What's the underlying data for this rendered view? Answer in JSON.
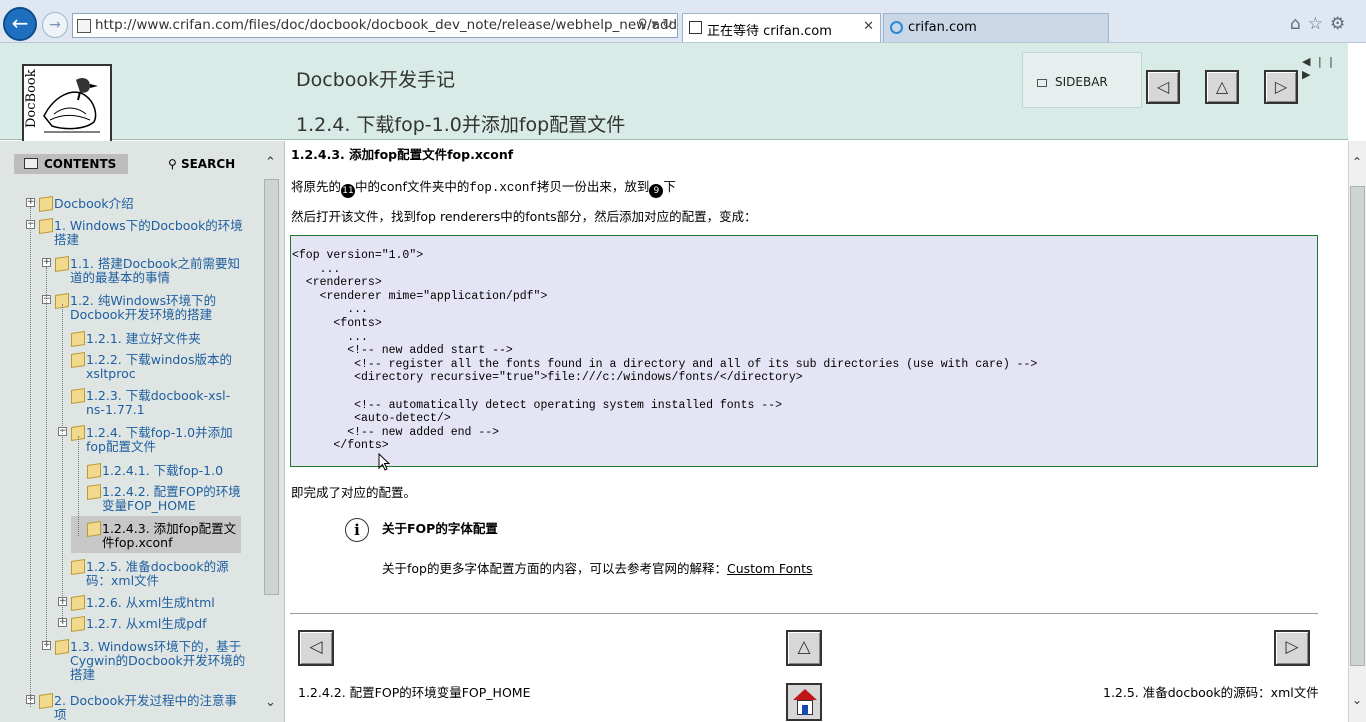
{
  "browser": {
    "url": "http://www.crifan.com/files/doc/docbook/docbook_dev_note/release/webhelp_new/add_fc",
    "tabs": [
      {
        "label": "正在等待 crifan.com"
      },
      {
        "label": "crifan.com"
      }
    ]
  },
  "header": {
    "logo_alt": "DocBook",
    "book_title": "Docbook开发手记",
    "section_title": "1.2.4. 下载fop-1.0并添加fop配置文件",
    "sidebar_label": "SIDEBAR",
    "nav_prev": "◁",
    "nav_up": "△",
    "nav_next": "▷",
    "ctl": "◀ | | ▶"
  },
  "sidebar": {
    "tab_contents": "CONTENTS",
    "tab_search": "SEARCH",
    "items": [
      {
        "label": "Docbook介绍",
        "lines": [
          "Docbook介绍"
        ],
        "exp": "+"
      },
      {
        "label": "1. Windows下的Docbook的环境搭建",
        "lines": [
          "1. Windows下的Docbook的环境",
          "搭建"
        ],
        "exp": "−"
      },
      {
        "label": "1.1. 搭建Docbook之前需要知道的最基本的事情",
        "lines": [
          "1.1. 搭建Docbook之前需要知",
          "道的最基本的事情"
        ],
        "exp": "+"
      },
      {
        "label": "1.2. 纯Windows环境下的Docbook开发环境的搭建",
        "lines": [
          "1.2. 纯Windows环境下的",
          "Docbook开发环境的搭建"
        ],
        "exp": "−"
      },
      {
        "label": "1.2.1. 建立好文件夹",
        "lines": [
          "1.2.1. 建立好文件夹"
        ],
        "exp": ""
      },
      {
        "label": "1.2.2. 下载windos版本的xsltproc",
        "lines": [
          "1.2.2. 下载windos版本的",
          "xsltproc"
        ],
        "exp": ""
      },
      {
        "label": "1.2.3. 下载docbook-xsl-ns-1.77.1",
        "lines": [
          "1.2.3. 下载docbook-xsl-",
          "ns-1.77.1"
        ],
        "exp": ""
      },
      {
        "label": "1.2.4. 下载fop-1.0并添加fop配置文件",
        "lines": [
          "1.2.4. 下载fop-1.0并添加",
          "fop配置文件"
        ],
        "exp": "−"
      },
      {
        "label": "1.2.4.1. 下载fop-1.0",
        "lines": [
          "1.2.4.1. 下载fop-1.0"
        ],
        "exp": ""
      },
      {
        "label": "1.2.4.2. 配置FOP的环境变量FOP_HOME",
        "lines": [
          "1.2.4.2. 配置FOP的环境",
          "变量FOP_HOME"
        ],
        "exp": ""
      },
      {
        "label": "1.2.4.3. 添加fop配置文件fop.xconf",
        "lines": [
          "1.2.4.3. 添加fop配置文",
          "件fop.xconf"
        ],
        "exp": ""
      },
      {
        "label": "1.2.5. 准备docbook的源码：xml文件",
        "lines": [
          "1.2.5. 准备docbook的源",
          "码：xml文件"
        ],
        "exp": ""
      },
      {
        "label": "1.2.6. 从xml生成html",
        "lines": [
          "1.2.6. 从xml生成html"
        ],
        "exp": "+"
      },
      {
        "label": "1.2.7. 从xml生成pdf",
        "lines": [
          "1.2.7. 从xml生成pdf"
        ],
        "exp": "+"
      },
      {
        "label": "1.3. Windows环境下的，基于Cygwin的Docbook开发环境的搭建",
        "lines": [
          "1.3. Windows环境下的，基于",
          "Cygwin的Docbook开发环境的",
          "搭建"
        ],
        "exp": "+"
      },
      {
        "label": "2. Docbook开发过程中的注意事项",
        "lines": [
          "2. Docbook开发过程中的注意事",
          "项"
        ],
        "exp": "+"
      }
    ]
  },
  "content": {
    "heading": "1.2.4.3. 添加fop配置文件fop.xconf",
    "para1_a": "将原先的",
    "para1_badge1": "11",
    "para1_b": "中的conf文件夹中的",
    "para1_code": "fop.xconf",
    "para1_c": "拷贝一份出来，放到",
    "para1_badge2": "9",
    "para1_d": "下",
    "para2": "然后打开该文件，找到fop  renderers中的fonts部分，然后添加对应的配置，变成：",
    "code": "<fop version=\"1.0\">\n    ...\n  <renderers>\n    <renderer mime=\"application/pdf\">\n        ...\n      <fonts>\n        ...\n        <!-- new added start -->\n         <!-- register all the fonts found in a directory and all of its sub directories (use with care) -->\n         <directory recursive=\"true\">file:///c:/windows/fonts/</directory>\n\n         <!-- automatically detect operating system installed fonts -->\n         <auto-detect/>\n        <!-- new added end -->\n      </fonts>",
    "para3": "即完成了对应的配置。",
    "note_icon": "i",
    "note_title": "关于FOP的字体配置",
    "note_text": "关于fop的更多字体配置方面的内容，可以去参考官网的解释：",
    "note_link": "Custom Fonts",
    "footer_prev": "1.2.4.2. 配置FOP的环境变量FOP_HOME",
    "footer_next": "1.2.5. 准备docbook的源码：xml文件"
  }
}
